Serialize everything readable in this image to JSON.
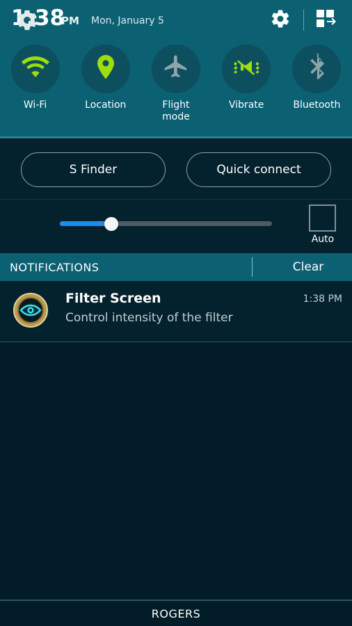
{
  "status_bar": {
    "time": "1:38",
    "ampm": "PM",
    "date": "Mon, January 5",
    "settings_icon": "gear-icon",
    "quick_settings_icon": "edit-quick-settings-grid-icon"
  },
  "quick_toggles": [
    {
      "label": "Wi-Fi",
      "icon": "wifi-icon",
      "state": "on",
      "color": "#9ede0e"
    },
    {
      "label": "Location",
      "icon": "location-pin-icon",
      "state": "on",
      "color": "#9ede0e"
    },
    {
      "label": "Flight\nmode",
      "icon": "airplane-icon",
      "state": "off",
      "color": "#8fa5aa"
    },
    {
      "label": "Vibrate",
      "icon": "vibrate-icon",
      "state": "on",
      "color": "#9ede0e"
    },
    {
      "label": "Bluetooth",
      "icon": "bluetooth-icon",
      "state": "off",
      "color": "#8fa5aa"
    }
  ],
  "shortcuts": {
    "s_finder": "S Finder",
    "quick_connect": "Quick connect"
  },
  "brightness": {
    "icon": "brightness-gear-icon",
    "value_percent": 25,
    "auto_label": "Auto",
    "auto_checked": false,
    "fill_color": "#1b8cf0"
  },
  "notifications_header": {
    "title": "NOTIFICATIONS",
    "clear_label": "Clear"
  },
  "notifications": [
    {
      "icon": "filter-screen-eye-icon",
      "app": "Filter Screen",
      "text": "Control intensity of the filter",
      "time": "1:38 PM"
    }
  ],
  "carrier": {
    "name": "ROGERS"
  },
  "colors": {
    "panel_teal": "#0b6072",
    "body_dark": "#021d27",
    "accent_green": "#9ede0e",
    "slider_blue": "#1b8cf0"
  }
}
